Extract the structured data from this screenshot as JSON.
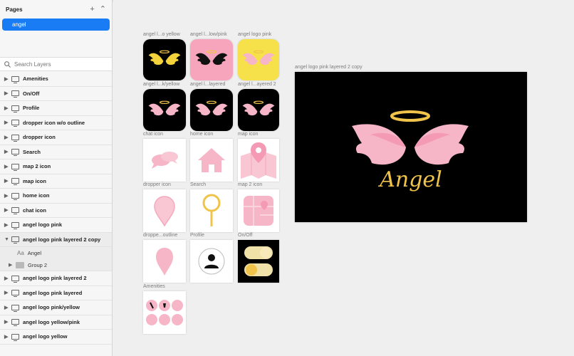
{
  "pages": {
    "title": "Pages",
    "items": [
      "angel"
    ]
  },
  "search": {
    "placeholder": "Search Layers"
  },
  "layers": [
    "Amenities",
    "On/Off",
    "Profile",
    "dropper icon w/o outline",
    "dropper icon",
    "Search",
    "map 2 icon",
    "map icon",
    "home icon",
    "chat icon",
    "angel logo pink",
    "angel logo pink layered 2 copy"
  ],
  "sublayers": [
    "Angel",
    "Group 2"
  ],
  "layers_after": [
    "angel logo pink layered 2",
    "angel logo pink layered",
    "angel logo pink/yellow",
    "angel logo yellow/pink",
    "angel logo yellow"
  ],
  "artboards": [
    "angel l...o yellow",
    "angel l...low/pink",
    "angel logo pink",
    "angel l...k/yellow",
    "angel l...layered",
    "angel l...ayered 2",
    "chat icon",
    "home icon",
    "map icon",
    "dropper icon",
    "Search",
    "map 2 icon",
    "droppe...outline",
    "Profile",
    "On/Off",
    "Amenities"
  ],
  "preview": {
    "label": "angel logo pink layered 2 copy",
    "text": "Angel"
  },
  "colors": {
    "accent": "#1a7cf5",
    "pink": "#f7b6c8",
    "yellow": "#f0c34a",
    "black": "#000000"
  }
}
